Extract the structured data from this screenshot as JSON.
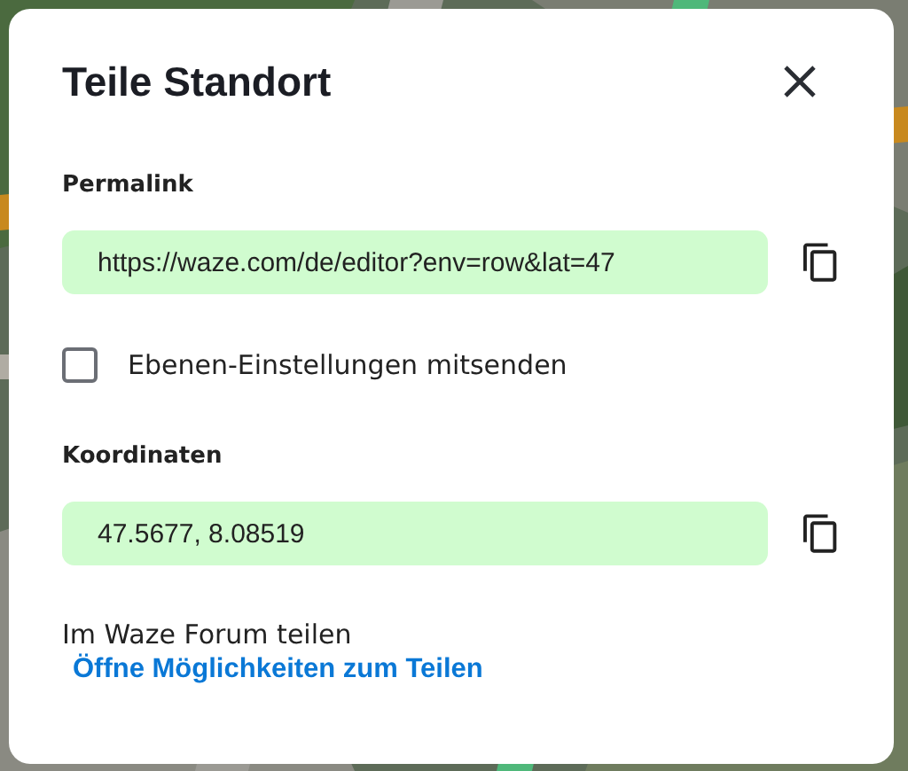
{
  "dialog": {
    "title": "Teile Standort",
    "permalink": {
      "label": "Permalink",
      "value": "https://waze.com/de/editor?env=row&lat=47"
    },
    "layers_option": {
      "label": "Ebenen-Einstellungen mitsenden",
      "checked": false
    },
    "coordinates": {
      "label": "Koordinaten",
      "value": "47.5677, 8.08519"
    },
    "forum": {
      "text": "Im Waze Forum teilen",
      "link": "Öffne Möglichkeiten zum Teilen"
    }
  }
}
